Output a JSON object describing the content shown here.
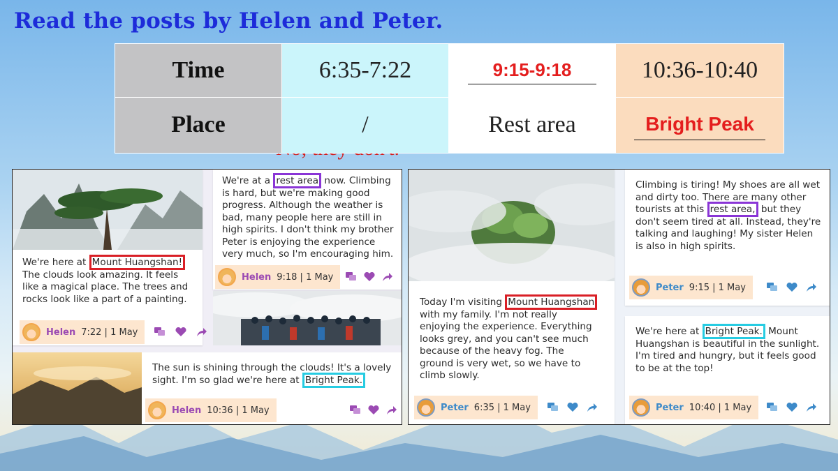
{
  "heading": "Read the posts by Helen and Peter.",
  "hidden_answer": "No, they don't.",
  "table": {
    "row1": {
      "label": "Time",
      "c1": "6:35-7:22",
      "c2": "9:15-9:18",
      "c3": "10:36-10:40"
    },
    "row2": {
      "label": "Place",
      "c1": "/",
      "c2": "Rest area",
      "c3": "Bright Peak"
    }
  },
  "posts": {
    "h1": {
      "pre": "We're here at ",
      "mark": "Mount Huangshan!",
      "post": "\nThe clouds look amazing. It feels\nlike a magical place. The trees and\nrocks look like a part of a painting.",
      "author": "Helen",
      "stamp": "7:22 | 1 May"
    },
    "h2": {
      "pre": "We're at a ",
      "mark": "rest area",
      "post": " now. Climbing\nis hard, but we're making good\nprogress. Although the weather is\nbad, many people here are still in\nhigh spirits. I don't think my brother\nPeter is enjoying the experience\nvery much, so I'm encouraging him.",
      "author": "Helen",
      "stamp": "9:18 | 1 May"
    },
    "h3": {
      "pre": "The sun is shining through the clouds! It's a lovely\nsight. I'm so glad we're here at ",
      "mark": "Bright Peak.",
      "post": "",
      "author": "Helen",
      "stamp": "10:36 | 1 May"
    },
    "p1": {
      "pre": "Today I'm visiting ",
      "mark": "Mount Huangshan",
      "post": "\nwith my family. I'm not really\nenjoying the experience. Everything\nlooks grey, and you can't see much\nbecause of the heavy fog. The\nground is very wet, so we have to\nclimb slowly.",
      "author": "Peter",
      "stamp": "6:35 | 1 May"
    },
    "p2": {
      "pre": "Climbing is tiring! My shoes are all wet\nand dirty too. There are many other\ntourists at this ",
      "mark": "rest area,",
      "post": " but they\ndon't seem tired at all. Instead, they're\ntalking and laughing! My sister Helen\nis also in high spirits.",
      "author": "Peter",
      "stamp": "9:15 | 1 May"
    },
    "p3": {
      "pre": "We're here at ",
      "mark": "Bright Peak.",
      "post": " Mount\nHuangshan is beautiful in the sunlight.\nI'm tired and hungry, but it feels good\nto be at the top!",
      "author": "Peter",
      "stamp": "10:40 | 1 May"
    }
  },
  "icons": {
    "comment": "comment-icon",
    "like": "heart-icon",
    "share": "share-icon"
  },
  "colors": {
    "heading": "#1d2bd9",
    "answer": "#e41e1e",
    "helen": "#9b4ab3",
    "peter": "#3d8ac9",
    "red_box": "#d91f26",
    "purple_box": "#8a35d6",
    "cyan_box": "#27cce2"
  }
}
